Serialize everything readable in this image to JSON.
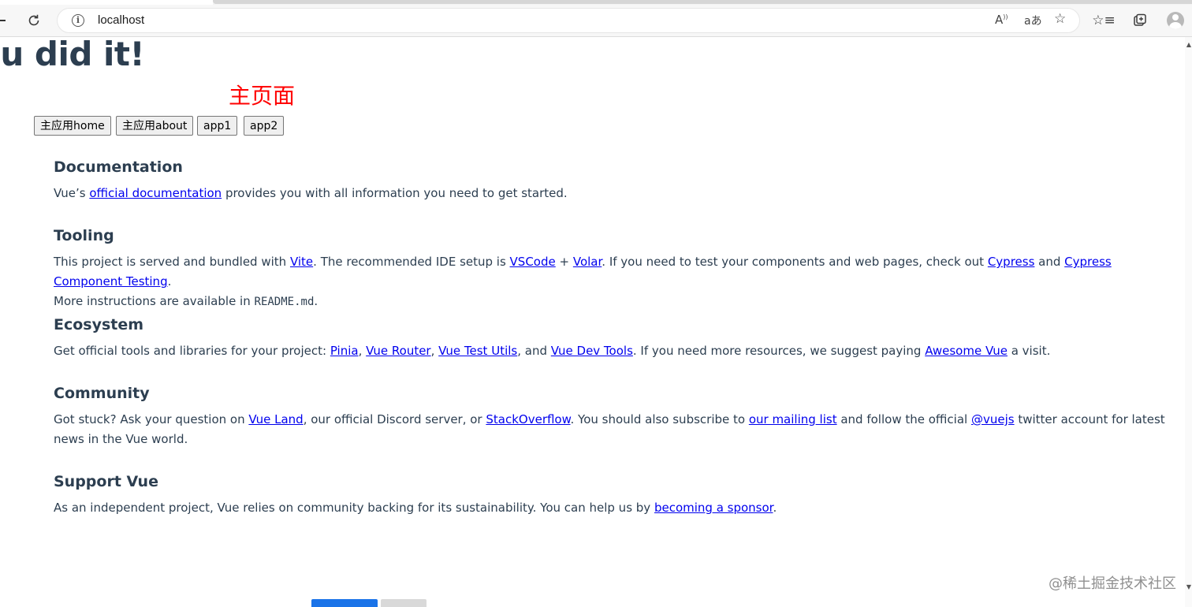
{
  "browser": {
    "url": "localhost",
    "icons": {
      "refresh": "refresh-icon",
      "info": "info-icon",
      "read_aloud": "read-aloud-icon",
      "translate": "translate-icon",
      "add_favorite": "add-favorite-icon",
      "favorites": "favorites-icon",
      "collections": "collections-icon",
      "profile": "profile-icon"
    }
  },
  "page": {
    "headline": "ou did it!",
    "main_title": "主页面",
    "title_color": "#ff0000",
    "nav_buttons": [
      "主应用home",
      "主应用about",
      "app1",
      "app2"
    ],
    "sections": [
      {
        "heading": "Documentation",
        "parts": [
          "Vue’s ",
          "official documentation",
          " provides you with all information you need to get started."
        ]
      },
      {
        "heading": "Tooling",
        "parts": [
          "This project is served and bundled with ",
          "Vite",
          ". The recommended IDE setup is ",
          "VSCode",
          " + ",
          "Volar",
          ". If you need to test your components and web pages, check out ",
          "Cypress",
          " and ",
          "Cypress Component Testing",
          ".",
          "More instructions are available in ",
          "README.md",
          "."
        ]
      },
      {
        "heading": "Ecosystem",
        "parts": [
          "Get official tools and libraries for your project: ",
          "Pinia",
          ", ",
          "Vue Router",
          ", ",
          "Vue Test Utils",
          ", and ",
          "Vue Dev Tools",
          ". If you need more resources, we suggest paying ",
          "Awesome Vue",
          " a visit."
        ]
      },
      {
        "heading": "Community",
        "parts": [
          "Got stuck? Ask your question on ",
          "Vue Land",
          ", our official Discord server, or ",
          "StackOverflow",
          ". You should also subscribe to ",
          "our mailing list",
          " and follow the official ",
          "@vuejs",
          " twitter account for latest news in the Vue world."
        ]
      },
      {
        "heading": "Support Vue",
        "parts": [
          "As an independent project, Vue relies on community backing for its sustainability. You can help us by ",
          "becoming a sponsor",
          "."
        ]
      }
    ],
    "link_color": "#0000ee",
    "text_color": "#2c3e50"
  },
  "watermark": "@稀土掘金技术社区"
}
